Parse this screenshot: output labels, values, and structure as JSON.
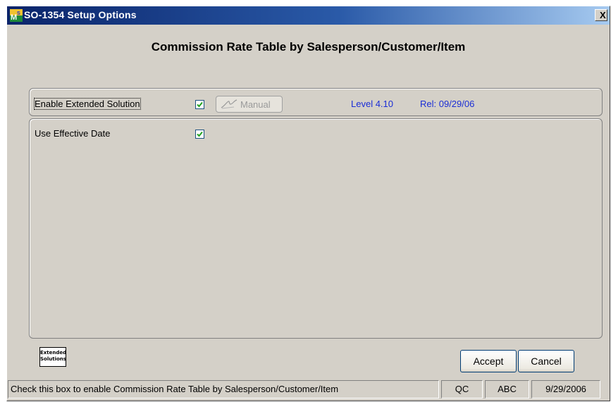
{
  "window": {
    "title": "SO-1354 Setup Options",
    "close_label": "X"
  },
  "heading": "Commission Rate Table by Salesperson/Customer/Item",
  "options": {
    "enable_label": "Enable Extended Solution",
    "enable_checked": true,
    "manual_label": "Manual",
    "level": "Level 4.10",
    "release": "Rel: 09/29/06",
    "effective_label": "Use Effective Date",
    "effective_checked": true
  },
  "logo": {
    "line1": "Extended",
    "line2": "Solutions"
  },
  "buttons": {
    "accept_label": "Accept",
    "cancel_label": "Cancel"
  },
  "status": {
    "message": "Check this box to enable Commission Rate Table by Salesperson/Customer/Item",
    "company": "QC",
    "user": "ABC",
    "date": "9/29/2006"
  },
  "colors": {
    "titlebar": "#0a246a",
    "dialog": "#d4d0c8",
    "level_text": "#1a2dd6",
    "check": "#21a121"
  }
}
